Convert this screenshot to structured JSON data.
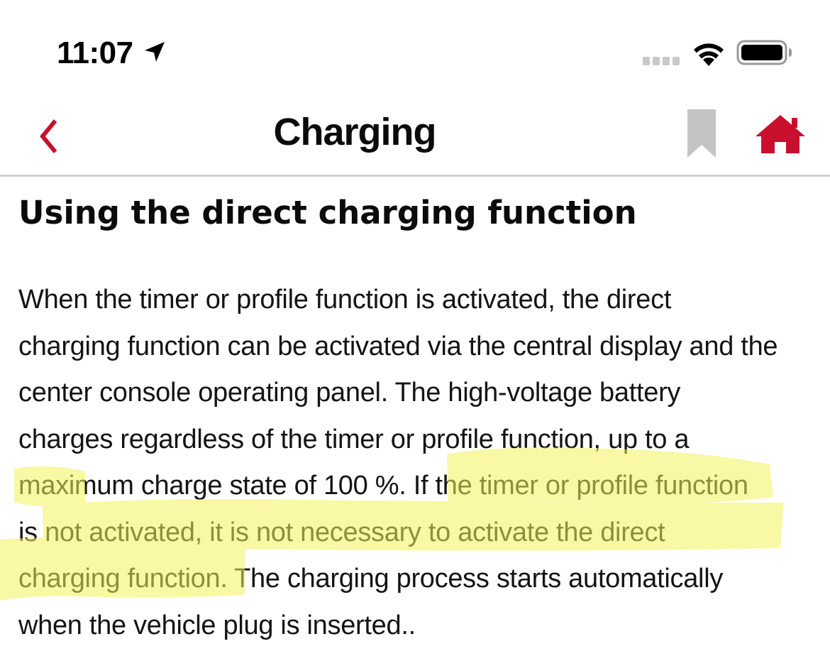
{
  "status_bar": {
    "time": "11:07",
    "icons": [
      "location-arrow-icon",
      "cellular-signal-icon",
      "wifi-icon",
      "battery-icon"
    ]
  },
  "nav": {
    "title": "Charging",
    "back_icon": "chevron-left-icon",
    "bookmark_icon": "bookmark-icon",
    "home_icon": "home-icon"
  },
  "article": {
    "heading": "Using the direct charging function",
    "lines": [
      "When the timer or profile function is activated, the direct",
      "charging function can be activated via the central display and the",
      "center console operating panel. The high-voltage battery",
      "charges regardless of the timer or profile function, up to a",
      "maximum charge state of 100 %. If the timer or profile function",
      "is not activated, it is not necessary to activate the direct",
      "charging function. The charging process starts automatically",
      "when the vehicle plug is inserted.."
    ]
  },
  "colors": {
    "accent_red": "#c8102e",
    "bookmark_gray": "#c4c4c4",
    "highlight_yellow": "#f3f25a",
    "divider": "#cfcfcf"
  }
}
